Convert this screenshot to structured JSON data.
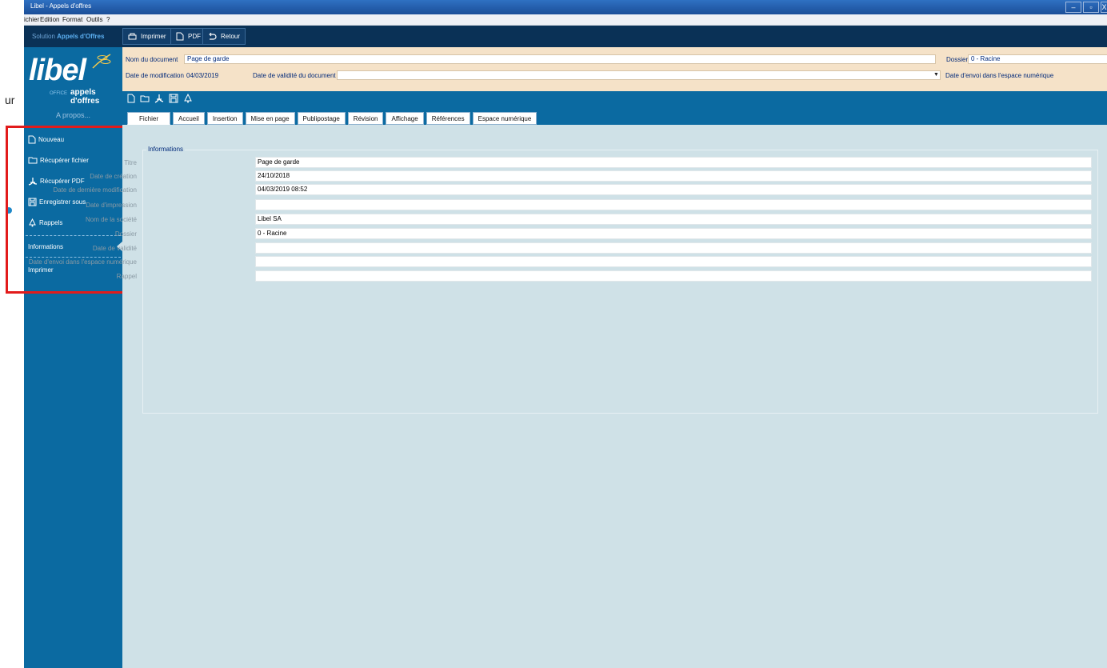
{
  "outside": {
    "text": "ur"
  },
  "window": {
    "title": "Libel - Appels d'offres",
    "controls": [
      "–",
      "▫",
      "X"
    ]
  },
  "menu": [
    "ichier",
    "Edition",
    "Format",
    "Outils",
    "?"
  ],
  "toolbar": {
    "solution_prefix": "Solution",
    "solution_name": "Appels d'Offres",
    "print_label": "Imprimer",
    "pdf_label": "PDF",
    "back_label": "Retour"
  },
  "logo": {
    "brand": "libel",
    "office": "OFFICE",
    "product": "appels d'offres"
  },
  "sidebar": {
    "apropos": "A propos...",
    "items": [
      {
        "label": "Nouveau",
        "icon": "new-document-icon"
      },
      {
        "label": "Récupérer fichier",
        "icon": "folder-icon"
      },
      {
        "label": "Récupérer PDF",
        "icon": "pdf-icon"
      },
      {
        "label": "Enregistrer sous",
        "icon": "save-icon"
      },
      {
        "label": "Rappels",
        "icon": "bell-icon"
      },
      {
        "label": "Informations"
      },
      {
        "label": "Imprimer"
      }
    ]
  },
  "header": {
    "doc_name_label": "Nom du document",
    "doc_name_value": "Page de garde",
    "folder_label": "Dossier",
    "folder_value": "0 - Racine",
    "mod_date_label": "Date de modification",
    "mod_date_value": "04/03/2019",
    "validity_label": "Date de validité du document",
    "validity_value": "",
    "send_date_label": "Date d'envoi dans l'espace numérique"
  },
  "ribbon": {
    "tabs": [
      "Fichier",
      "Accueil",
      "Insertion",
      "Mise en page",
      "Publipostage",
      "Révision",
      "Affichage",
      "Références",
      "Espace numérique"
    ],
    "active_tab": "Fichier"
  },
  "informations": {
    "title": "Informations",
    "fields": [
      {
        "label": "Titre",
        "value": "Page de garde"
      },
      {
        "label": "Date de création",
        "value": "24/10/2018"
      },
      {
        "label": "Date de dernière modification",
        "value": "04/03/2019 08:52"
      },
      {
        "label": "Date d'impression",
        "value": ""
      },
      {
        "label": "Nom de la société",
        "value": "Libel SA"
      },
      {
        "label": "Dossier",
        "value": "0 - Racine"
      },
      {
        "label": "Date de validité",
        "value": ""
      },
      {
        "label": "Date d'envoi dans l'espace numérique",
        "value": ""
      },
      {
        "label": "Rappel",
        "value": ""
      }
    ]
  },
  "colors": {
    "sidebar": "#0b6aa1",
    "toolbar": "#0a3156",
    "header": "#f5e2c8",
    "content": "#cfe1e7",
    "highlight": "#e21b1b"
  }
}
